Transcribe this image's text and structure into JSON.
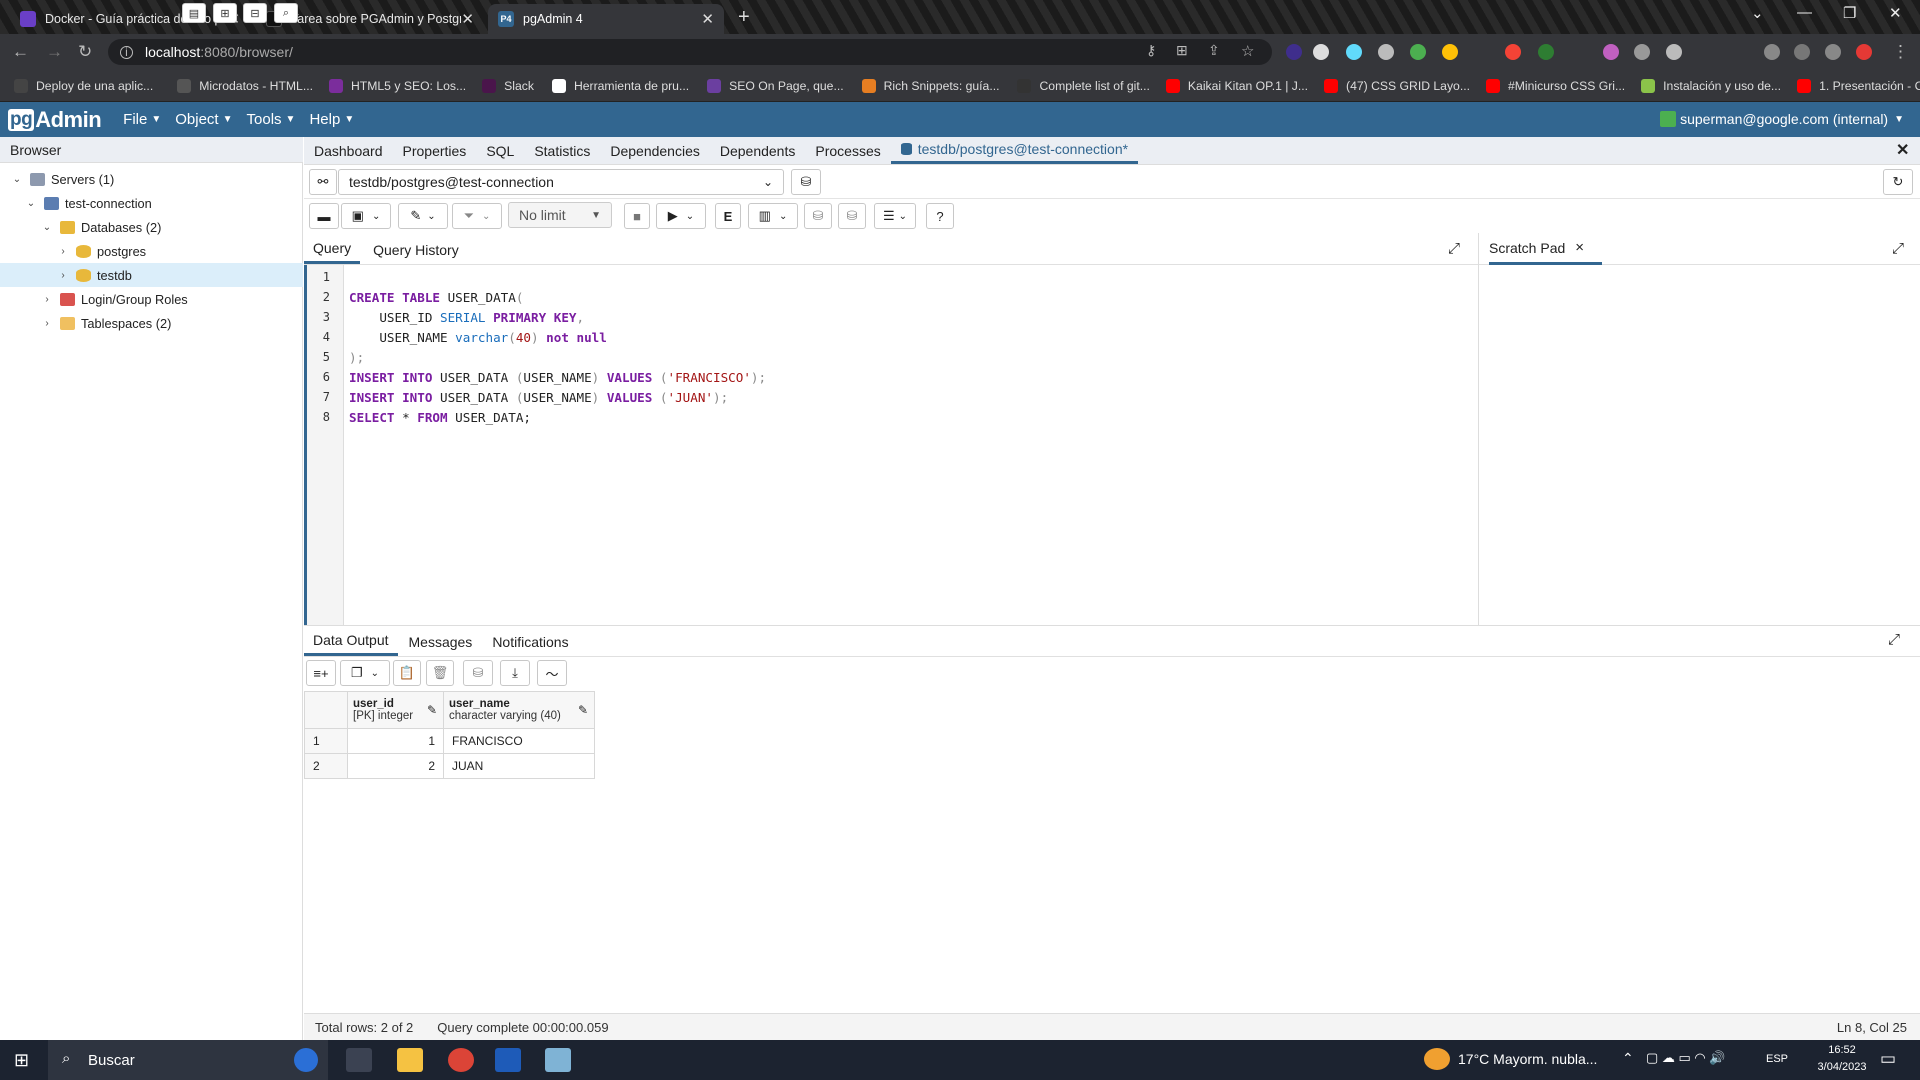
{
  "chrome": {
    "tabs": [
      {
        "title": "Docker - Guía práctica de uso pa",
        "color": "#6a3fc7"
      },
      {
        "title": "Tarea sobre PGAdmin y Postgres",
        "color": "#222222"
      },
      {
        "title": "pgAdmin 4",
        "color": "#326690",
        "favicon_text": "P4"
      }
    ],
    "url": "localhost:8080/browser/",
    "url_host": "localhost",
    "url_rest": ":8080/browser/"
  },
  "bookmarks": [
    {
      "label": "Deploy de una aplic...",
      "color": "#444"
    },
    {
      "label": "Microdatos - HTML...",
      "color": "#555"
    },
    {
      "label": "HTML5 y SEO: Los...",
      "color": "#7b2d9c"
    },
    {
      "label": "Slack",
      "color": "#4a154b"
    },
    {
      "label": "Herramienta de pru...",
      "color": "#ffffff"
    },
    {
      "label": "SEO On Page, que...",
      "color": "#6b3fa0"
    },
    {
      "label": "Rich Snippets: guía...",
      "color": "#e67e22"
    },
    {
      "label": "Complete list of git...",
      "color": "#333"
    },
    {
      "label": "Kaikai Kitan OP.1 | J...",
      "color": "#ff0000"
    },
    {
      "label": "(47) CSS GRID Layo...",
      "color": "#ff0000"
    },
    {
      "label": "#Minicurso CSS Gri...",
      "color": "#ff0000"
    },
    {
      "label": "Instalación y uso de...",
      "color": "#8bc34a"
    },
    {
      "label": "1. Presentación - C...",
      "color": "#ff0000"
    }
  ],
  "pgadmin": {
    "brand_pg": "pg",
    "brand_admin": "Admin",
    "menus": [
      "File",
      "Object",
      "Tools",
      "Help"
    ],
    "user": "superman@google.com (internal)",
    "accent": "#326690"
  },
  "browser": {
    "title": "Browser",
    "tree": [
      {
        "label": "Servers (1)",
        "level": 0,
        "expanded": true,
        "icon": "servers-icon"
      },
      {
        "label": "test-connection",
        "level": 1,
        "expanded": true,
        "icon": "server-icon"
      },
      {
        "label": "Databases (2)",
        "level": 2,
        "expanded": true,
        "icon": "databases-icon"
      },
      {
        "label": "postgres",
        "level": 3,
        "expanded": false,
        "icon": "database-icon"
      },
      {
        "label": "testdb",
        "level": 3,
        "expanded": false,
        "icon": "database-icon",
        "selected": true
      },
      {
        "label": "Login/Group Roles",
        "level": 2,
        "expanded": false,
        "icon": "roles-icon"
      },
      {
        "label": "Tablespaces (2)",
        "level": 2,
        "expanded": false,
        "icon": "tablespaces-icon"
      }
    ]
  },
  "main_tabs": [
    "Dashboard",
    "Properties",
    "SQL",
    "Statistics",
    "Dependencies",
    "Dependents",
    "Processes",
    "testdb/postgres@test-connection*"
  ],
  "connection": "testdb/postgres@test-connection",
  "toolbar": {
    "limit": "No limit"
  },
  "query_tabs": [
    "Query",
    "Query History"
  ],
  "scratch_pad": {
    "title": "Scratch Pad",
    "close": "×"
  },
  "code_lines": [
    {
      "n": "1",
      "parts": []
    },
    {
      "n": "2",
      "parts": [
        {
          "t": "CREATE TABLE ",
          "c": "kw"
        },
        {
          "t": "USER_DATA",
          "c": ""
        },
        {
          "t": "(",
          "c": "pu"
        }
      ]
    },
    {
      "n": "3",
      "parts": [
        {
          "t": "    USER_ID ",
          "c": ""
        },
        {
          "t": "SERIAL",
          "c": "ty"
        },
        {
          "t": " ",
          "c": ""
        },
        {
          "t": "PRIMARY KEY",
          "c": "kw"
        },
        {
          "t": ",",
          "c": "pu"
        }
      ]
    },
    {
      "n": "4",
      "parts": [
        {
          "t": "    USER_NAME ",
          "c": ""
        },
        {
          "t": "varchar",
          "c": "ty"
        },
        {
          "t": "(",
          "c": "pu"
        },
        {
          "t": "40",
          "c": "st"
        },
        {
          "t": ") ",
          "c": "pu"
        },
        {
          "t": "not null",
          "c": "kw"
        }
      ]
    },
    {
      "n": "5",
      "parts": [
        {
          "t": ");",
          "c": "pu"
        }
      ]
    },
    {
      "n": "6",
      "parts": [
        {
          "t": "INSERT INTO ",
          "c": "kw"
        },
        {
          "t": "USER_DATA ",
          "c": ""
        },
        {
          "t": "(",
          "c": "pu"
        },
        {
          "t": "USER_NAME",
          "c": ""
        },
        {
          "t": ") ",
          "c": "pu"
        },
        {
          "t": "VALUES ",
          "c": "kw"
        },
        {
          "t": "(",
          "c": "pu"
        },
        {
          "t": "'FRANCISCO'",
          "c": "st"
        },
        {
          "t": ");",
          "c": "pu"
        }
      ]
    },
    {
      "n": "7",
      "parts": [
        {
          "t": "INSERT INTO ",
          "c": "kw"
        },
        {
          "t": "USER_DATA ",
          "c": ""
        },
        {
          "t": "(",
          "c": "pu"
        },
        {
          "t": "USER_NAME",
          "c": ""
        },
        {
          "t": ") ",
          "c": "pu"
        },
        {
          "t": "VALUES ",
          "c": "kw"
        },
        {
          "t": "(",
          "c": "pu"
        },
        {
          "t": "'JUAN'",
          "c": "st"
        },
        {
          "t": ");",
          "c": "pu"
        }
      ]
    },
    {
      "n": "8",
      "parts": [
        {
          "t": "SELECT ",
          "c": "kw"
        },
        {
          "t": "* ",
          "c": ""
        },
        {
          "t": "FROM ",
          "c": "kw"
        },
        {
          "t": "USER_DATA;",
          "c": ""
        }
      ]
    }
  ],
  "output_tabs": [
    "Data Output",
    "Messages",
    "Notifications"
  ],
  "result": {
    "columns": [
      {
        "name": "user_id",
        "type": "[PK] integer"
      },
      {
        "name": "user_name",
        "type": "character varying (40)"
      }
    ],
    "rows": [
      {
        "idx": "1",
        "user_id": "1",
        "user_name": "FRANCISCO"
      },
      {
        "idx": "2",
        "user_id": "2",
        "user_name": "JUAN"
      }
    ]
  },
  "status": {
    "rows": "Total rows: 2 of 2",
    "query": "Query complete 00:00:00.059",
    "position": "Ln 8, Col 25"
  },
  "taskbar": {
    "search": "Buscar",
    "weather": "17°C  Mayorm. nubla...",
    "lang": "ESP",
    "time": "16:52",
    "date": "3/04/2023"
  }
}
